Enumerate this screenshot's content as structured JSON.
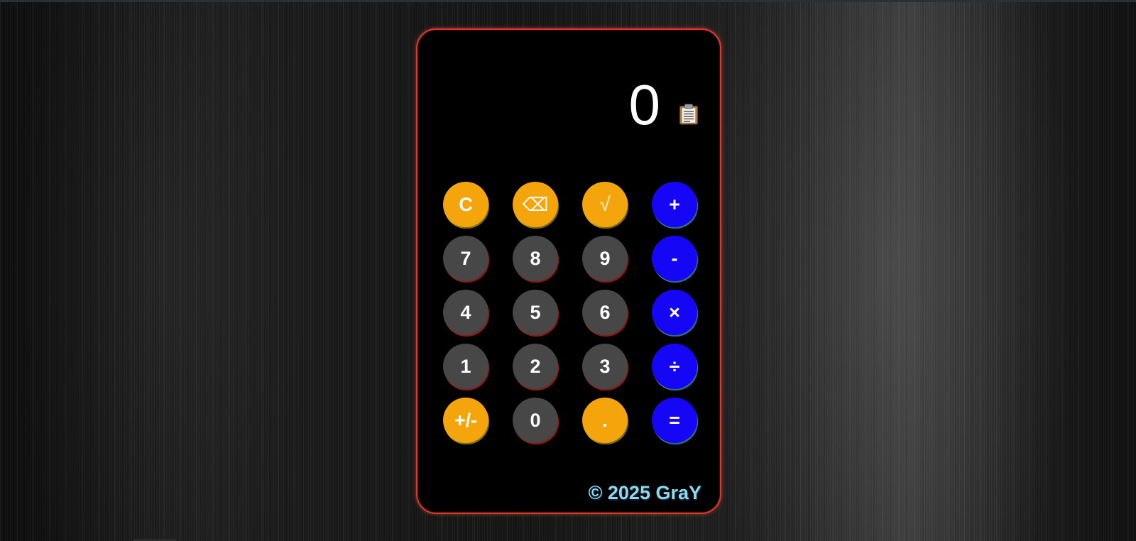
{
  "display": {
    "value": "0"
  },
  "icons": {
    "copy": "clipboard-icon"
  },
  "keys": [
    {
      "id": "clear",
      "label": "C",
      "kind": "func"
    },
    {
      "id": "backspace",
      "label": "⌫",
      "kind": "func"
    },
    {
      "id": "sqrt",
      "label": "√",
      "kind": "func"
    },
    {
      "id": "add",
      "label": "+",
      "kind": "op"
    },
    {
      "id": "7",
      "label": "7",
      "kind": "num"
    },
    {
      "id": "8",
      "label": "8",
      "kind": "num"
    },
    {
      "id": "9",
      "label": "9",
      "kind": "num"
    },
    {
      "id": "subtract",
      "label": "-",
      "kind": "op"
    },
    {
      "id": "4",
      "label": "4",
      "kind": "num"
    },
    {
      "id": "5",
      "label": "5",
      "kind": "num"
    },
    {
      "id": "6",
      "label": "6",
      "kind": "num"
    },
    {
      "id": "multiply",
      "label": "×",
      "kind": "op"
    },
    {
      "id": "1",
      "label": "1",
      "kind": "num"
    },
    {
      "id": "2",
      "label": "2",
      "kind": "num"
    },
    {
      "id": "3",
      "label": "3",
      "kind": "num"
    },
    {
      "id": "divide",
      "label": "÷",
      "kind": "op"
    },
    {
      "id": "negate",
      "label": "+/-",
      "kind": "func"
    },
    {
      "id": "0",
      "label": "0",
      "kind": "num"
    },
    {
      "id": "decimal",
      "label": ".",
      "kind": "func"
    },
    {
      "id": "equals",
      "label": "=",
      "kind": "op"
    }
  ],
  "footer": {
    "text": "© 2025 GraY"
  },
  "colors": {
    "number_key": "#474747",
    "function_key": "#f3a50b",
    "operator_key": "#1506f5",
    "frame_border": "#e0352b",
    "footer_text": "#8ed9ea"
  }
}
